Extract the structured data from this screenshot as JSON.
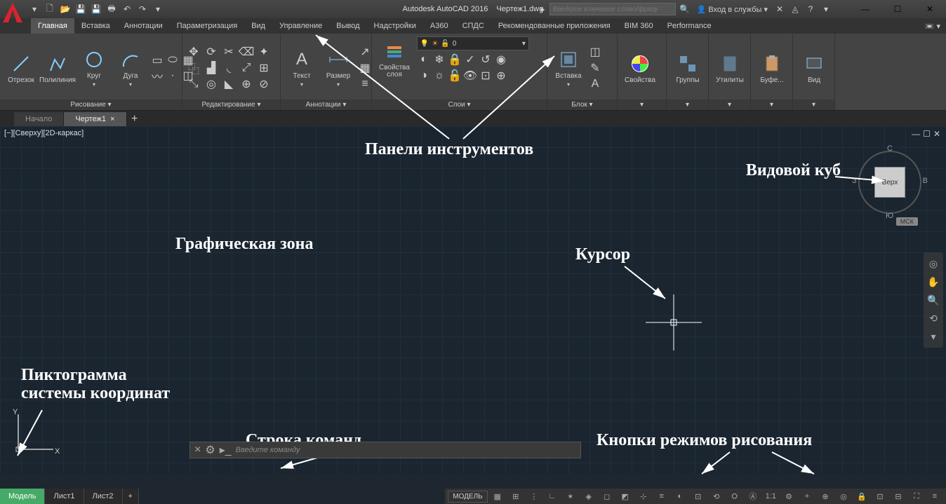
{
  "title": {
    "app": "Autodesk AutoCAD 2016",
    "file": "Чертеж1.dwg"
  },
  "search": {
    "placeholder": "Введите ключевое слово/фразу"
  },
  "signin": "Вход в службы",
  "menu": [
    "Главная",
    "Вставка",
    "Аннотации",
    "Параметризация",
    "Вид",
    "Управление",
    "Вывод",
    "Надстройки",
    "A360",
    "СПДС",
    "Рекомендованные приложения",
    "BIM 360",
    "Performance"
  ],
  "ribbon": {
    "draw": {
      "title": "Рисование ▾",
      "items": [
        "Отрезок",
        "Полилиния",
        "Круг",
        "Дуга"
      ]
    },
    "modify": {
      "title": "Редактирование ▾"
    },
    "annot": {
      "title": "Аннотации ▾",
      "text": "Текст",
      "dim": "Размер"
    },
    "layers": {
      "title": "Слои ▾",
      "props": "Свойства\nслоя",
      "current": "0"
    },
    "block": {
      "title": "Блок ▾",
      "insert": "Вставка"
    },
    "props": {
      "title": "",
      "label": "Свойства"
    },
    "groups": {
      "title": "",
      "label": "Группы"
    },
    "utils": {
      "title": "",
      "label": "Утилиты"
    },
    "clip": {
      "title": "",
      "label": "Буфе..."
    },
    "view": {
      "title": "",
      "label": "Вид"
    }
  },
  "filetabs": {
    "start": "Начало",
    "active": "Чертеж1"
  },
  "viewlabel": "[−][Сверху][2D-каркас]",
  "viewcube": {
    "face": "Верх",
    "n": "С",
    "s": "Ю",
    "e": "В",
    "w": "З",
    "msk": "МСК"
  },
  "cmdline": {
    "prompt": "Введите команду"
  },
  "bottomtabs": [
    "Модель",
    "Лист1",
    "Лист2"
  ],
  "status": {
    "model": "МОДЕЛЬ",
    "scale": "1:1"
  },
  "annotations": {
    "toolpanels": "Панели инструментов",
    "viewcube": "Видовой куб",
    "graphzone": "Графическая зона",
    "cursor": "Курсор",
    "ucs": "Пиктограмма\nсистемы координат",
    "cmdline": "Строка команд",
    "drawmodes": "Кнопки режимов рисования"
  }
}
